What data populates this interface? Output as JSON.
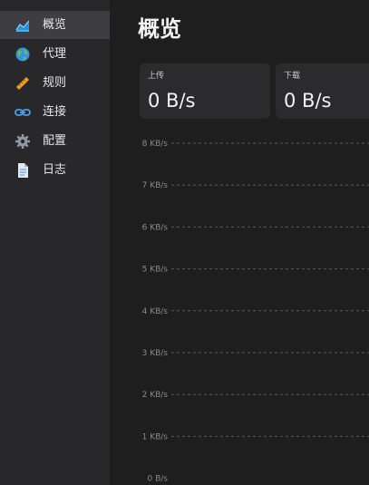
{
  "sidebar": {
    "items": [
      {
        "label": "概览",
        "icon": "chart-area-icon",
        "active": true
      },
      {
        "label": "代理",
        "icon": "globe-icon",
        "active": false
      },
      {
        "label": "规则",
        "icon": "ruler-icon",
        "active": false
      },
      {
        "label": "连接",
        "icon": "link-icon",
        "active": false
      },
      {
        "label": "配置",
        "icon": "gear-icon",
        "active": false
      },
      {
        "label": "日志",
        "icon": "document-icon",
        "active": false
      }
    ]
  },
  "page": {
    "title": "概览"
  },
  "stats": {
    "upload": {
      "label": "上传",
      "value": "0 B/s"
    },
    "download": {
      "label": "下载",
      "value": "0 B/s"
    }
  },
  "chart_data": {
    "type": "line",
    "title": "",
    "y_tick_labels": [
      "8 KB/s",
      "7 KB/s",
      "6 KB/s",
      "5 KB/s",
      "4 KB/s",
      "3 KB/s",
      "2 KB/s",
      "1 KB/s",
      "0 B/s"
    ],
    "ylim": [
      0,
      8
    ],
    "grid": true,
    "series": []
  },
  "colors": {
    "sidebar_bg": "#28282b",
    "sidebar_active": "#3d3d42",
    "main_bg": "#1e1e1e",
    "card_bg": "#2b2b2e",
    "grid": "#5a5a5a",
    "tick_text": "#8a8a8a"
  }
}
